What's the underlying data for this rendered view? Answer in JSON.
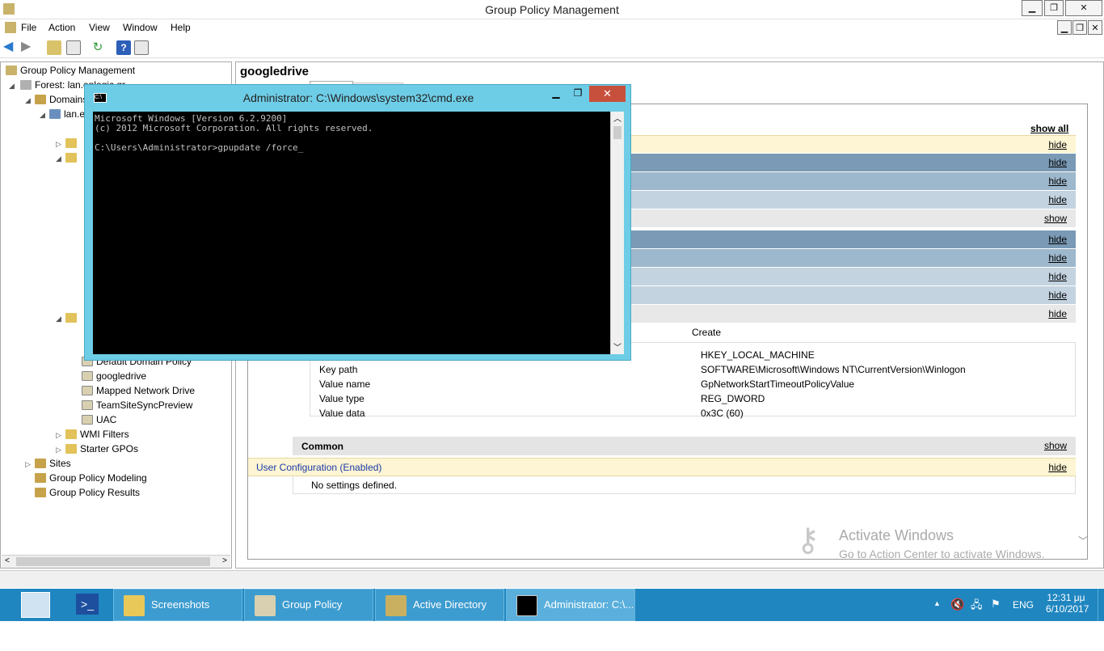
{
  "window": {
    "title": "Group Policy Management"
  },
  "menu": [
    "File",
    "Action",
    "View",
    "Window",
    "Help"
  ],
  "tree": {
    "root": "Group Policy Management",
    "forest": "Forest: lan.enlogic.gr",
    "domains": "Domains",
    "domain": "lan.e",
    "gpos": [
      "Default Domain Policy",
      "googledrive",
      "Mapped Network Drive",
      "TeamSiteSyncPreview",
      "UAC"
    ],
    "wmi": "WMI Filters",
    "starter": "Starter GPOs",
    "sites": "Sites",
    "modeling": "Group Policy Modeling",
    "results": "Group Policy Results"
  },
  "right": {
    "gpo_title": "googledrive",
    "show_all": "show all",
    "hide": "hide",
    "show": "show",
    "create": "Create",
    "kv": [
      {
        "key": "",
        "value": "HKEY_LOCAL_MACHINE"
      },
      {
        "key": "Key path",
        "value": "SOFTWARE\\Microsoft\\Windows NT\\CurrentVersion\\Winlogon"
      },
      {
        "key": "Value name",
        "value": "GpNetworkStartTimeoutPolicyValue"
      },
      {
        "key": "Value type",
        "value": "REG_DWORD"
      },
      {
        "key": "Value data",
        "value": "0x3C (60)"
      }
    ],
    "common": "Common",
    "user_config": "User Configuration (Enabled)",
    "no_settings": "No settings defined."
  },
  "cmd": {
    "title": "Administrator: C:\\Windows\\system32\\cmd.exe",
    "line1": "Microsoft Windows [Version 6.2.9200]",
    "line2": "(c) 2012 Microsoft Corporation. All rights reserved.",
    "line3": "C:\\Users\\Administrator>gpupdate /force_"
  },
  "watermark": {
    "line1": "Activate Windows",
    "line2": "Go to Action Center to activate Windows."
  },
  "taskbar": {
    "items": [
      "Screenshots",
      "Group Policy Man...",
      "Active Directory U...",
      "Administrator: C:\\..."
    ],
    "lang": "ENG",
    "time": "12:31 μμ",
    "date": "6/10/2017"
  },
  "colors": {
    "taskbar": "#1f86c0",
    "cmd_frame": "#6ecde6",
    "band_dark": "#7a9ab5",
    "band_mid": "#9db7cc",
    "band_light": "#c3d3e0",
    "band_yellow": "#fdf5d3"
  }
}
